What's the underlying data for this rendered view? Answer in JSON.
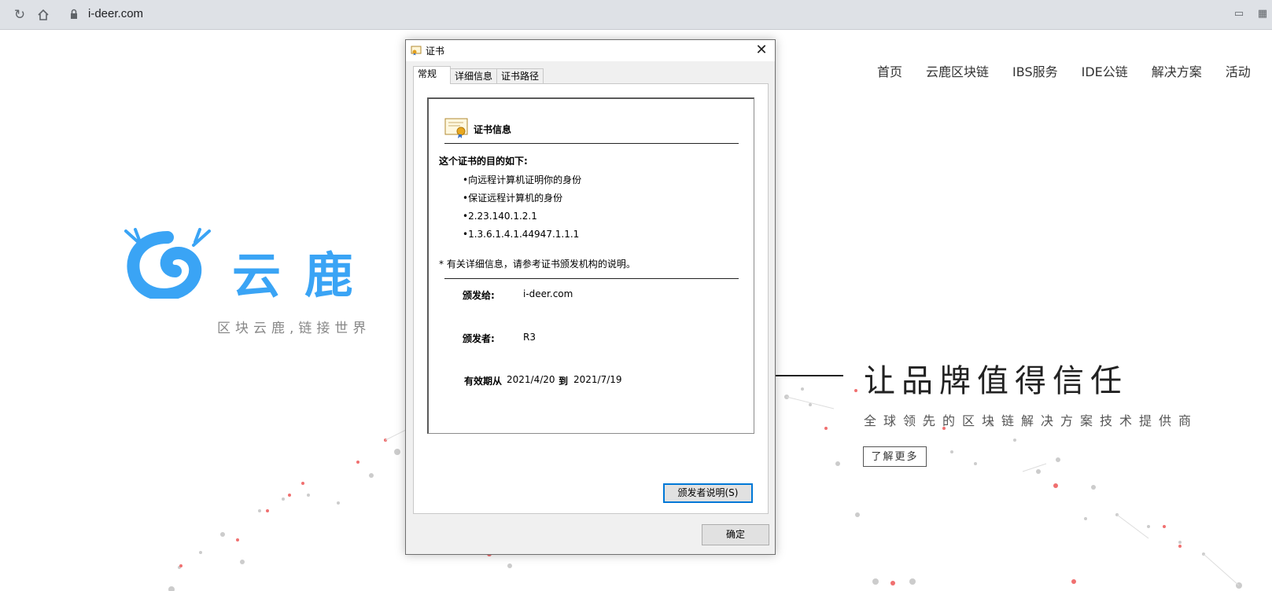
{
  "browser": {
    "url": "i-deer.com"
  },
  "site": {
    "nav": [
      "首页",
      "云鹿区块链",
      "IBS服务",
      "IDE公链",
      "解决方案",
      "活动"
    ],
    "logo_text": "云鹿",
    "slogan": "区块云鹿,链接世界",
    "hero_title": "让品牌值得信任",
    "hero_subtitle": "全球领先的区块链解决方案技术提供商",
    "hero_button": "了解更多",
    "brand_color": "#3aa4f5"
  },
  "dialog": {
    "title": "证书",
    "tabs": [
      "常规",
      "详细信息",
      "证书路径"
    ],
    "active_tab": "常规",
    "cert_header": "证书信息",
    "purpose_title": "这个证书的目的如下:",
    "purposes": [
      "向远程计算机证明你的身份",
      "保证远程计算机的身份",
      "2.23.140.1.2.1",
      "1.3.6.1.4.1.44947.1.1.1"
    ],
    "footnote": "* 有关详细信息，请参考证书颁发机构的说明。",
    "issued_to_label": "颁发给:",
    "issued_to": "i-deer.com",
    "issued_by_label": "颁发者:",
    "issued_by": "R3",
    "valid_from_label": "有效期从",
    "valid_from": "2021/4/20",
    "valid_to_label": "到",
    "valid_to": "2021/7/19",
    "issuer_statement_button": "颁发者说明(S)",
    "ok_button": "确定",
    "focus_color": "#0078d7"
  }
}
